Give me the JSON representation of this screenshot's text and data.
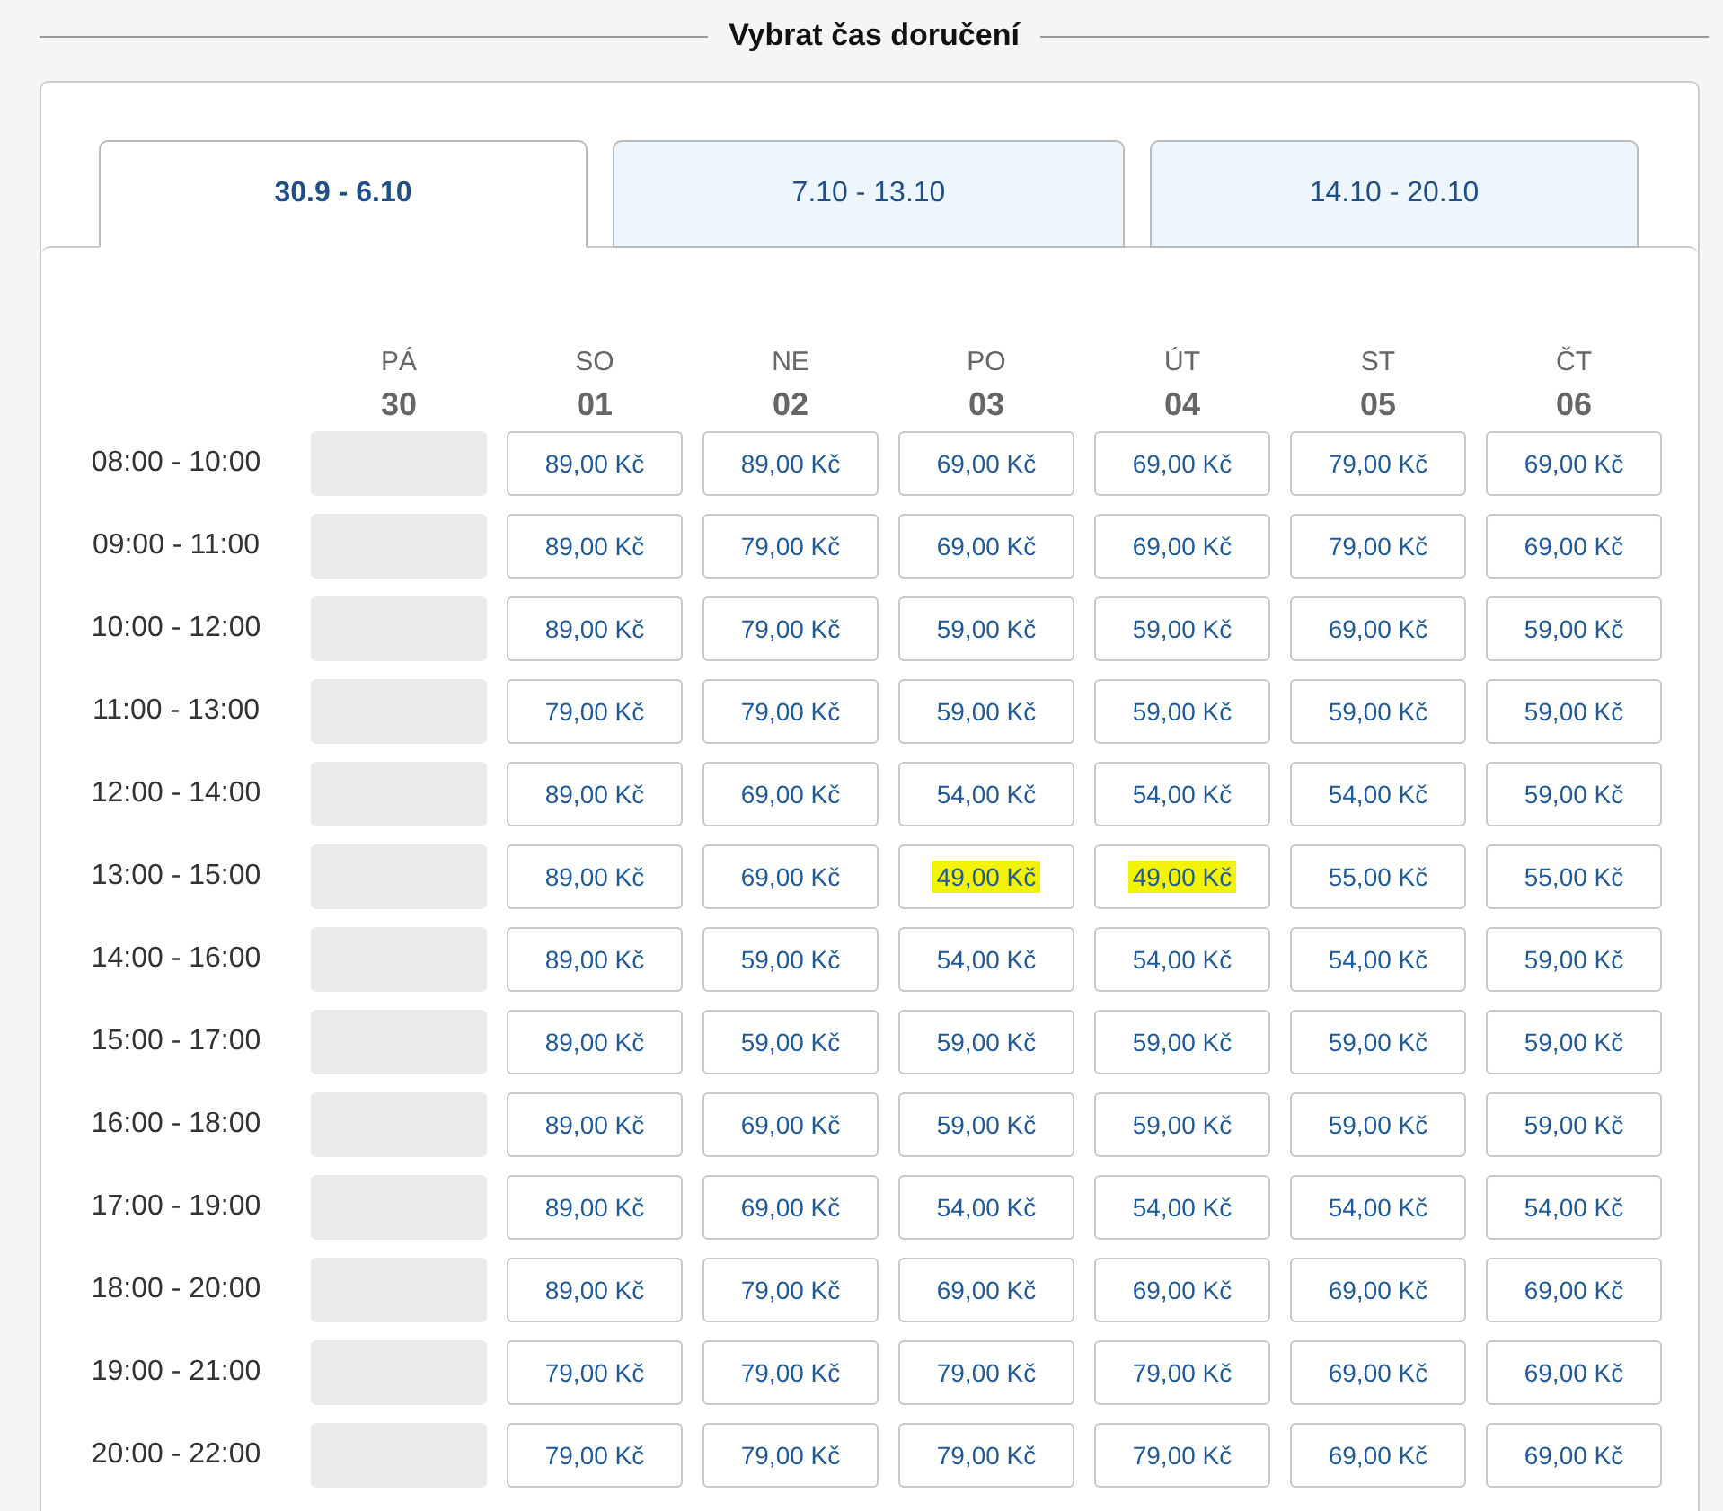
{
  "title": "Vybrat čas doručení",
  "tabs": [
    {
      "label": "30.9 - 6.10",
      "selected": true
    },
    {
      "label": "7.10 - 13.10",
      "selected": false
    },
    {
      "label": "14.10 - 20.10",
      "selected": false
    }
  ],
  "days": [
    {
      "name": "PÁ",
      "date": "30"
    },
    {
      "name": "SO",
      "date": "01"
    },
    {
      "name": "NE",
      "date": "02"
    },
    {
      "name": "PO",
      "date": "03"
    },
    {
      "name": "ÚT",
      "date": "04"
    },
    {
      "name": "ST",
      "date": "05"
    },
    {
      "name": "ČT",
      "date": "06"
    }
  ],
  "rows": [
    {
      "time": "08:00 - 10:00",
      "slots": [
        {
          "available": false
        },
        {
          "available": true,
          "price": "89,00 Kč",
          "highlighted": false
        },
        {
          "available": true,
          "price": "89,00 Kč",
          "highlighted": false
        },
        {
          "available": true,
          "price": "69,00 Kč",
          "highlighted": false
        },
        {
          "available": true,
          "price": "69,00 Kč",
          "highlighted": false
        },
        {
          "available": true,
          "price": "79,00 Kč",
          "highlighted": false
        },
        {
          "available": true,
          "price": "69,00 Kč",
          "highlighted": false
        }
      ]
    },
    {
      "time": "09:00 - 11:00",
      "slots": [
        {
          "available": false
        },
        {
          "available": true,
          "price": "89,00 Kč",
          "highlighted": false
        },
        {
          "available": true,
          "price": "79,00 Kč",
          "highlighted": false
        },
        {
          "available": true,
          "price": "69,00 Kč",
          "highlighted": false
        },
        {
          "available": true,
          "price": "69,00 Kč",
          "highlighted": false
        },
        {
          "available": true,
          "price": "79,00 Kč",
          "highlighted": false
        },
        {
          "available": true,
          "price": "69,00 Kč",
          "highlighted": false
        }
      ]
    },
    {
      "time": "10:00 - 12:00",
      "slots": [
        {
          "available": false
        },
        {
          "available": true,
          "price": "89,00 Kč",
          "highlighted": false
        },
        {
          "available": true,
          "price": "79,00 Kč",
          "highlighted": false
        },
        {
          "available": true,
          "price": "59,00 Kč",
          "highlighted": false
        },
        {
          "available": true,
          "price": "59,00 Kč",
          "highlighted": false
        },
        {
          "available": true,
          "price": "69,00 Kč",
          "highlighted": false
        },
        {
          "available": true,
          "price": "59,00 Kč",
          "highlighted": false
        }
      ]
    },
    {
      "time": "11:00 - 13:00",
      "slots": [
        {
          "available": false
        },
        {
          "available": true,
          "price": "79,00 Kč",
          "highlighted": false
        },
        {
          "available": true,
          "price": "79,00 Kč",
          "highlighted": false
        },
        {
          "available": true,
          "price": "59,00 Kč",
          "highlighted": false
        },
        {
          "available": true,
          "price": "59,00 Kč",
          "highlighted": false
        },
        {
          "available": true,
          "price": "59,00 Kč",
          "highlighted": false
        },
        {
          "available": true,
          "price": "59,00 Kč",
          "highlighted": false
        }
      ]
    },
    {
      "time": "12:00 - 14:00",
      "slots": [
        {
          "available": false
        },
        {
          "available": true,
          "price": "89,00 Kč",
          "highlighted": false
        },
        {
          "available": true,
          "price": "69,00 Kč",
          "highlighted": false
        },
        {
          "available": true,
          "price": "54,00 Kč",
          "highlighted": false
        },
        {
          "available": true,
          "price": "54,00 Kč",
          "highlighted": false
        },
        {
          "available": true,
          "price": "54,00 Kč",
          "highlighted": false
        },
        {
          "available": true,
          "price": "59,00 Kč",
          "highlighted": false
        }
      ]
    },
    {
      "time": "13:00 - 15:00",
      "slots": [
        {
          "available": false
        },
        {
          "available": true,
          "price": "89,00 Kč",
          "highlighted": false
        },
        {
          "available": true,
          "price": "69,00 Kč",
          "highlighted": false
        },
        {
          "available": true,
          "price": "49,00 Kč",
          "highlighted": true
        },
        {
          "available": true,
          "price": "49,00 Kč",
          "highlighted": true
        },
        {
          "available": true,
          "price": "55,00 Kč",
          "highlighted": false
        },
        {
          "available": true,
          "price": "55,00 Kč",
          "highlighted": false
        }
      ]
    },
    {
      "time": "14:00 - 16:00",
      "slots": [
        {
          "available": false
        },
        {
          "available": true,
          "price": "89,00 Kč",
          "highlighted": false
        },
        {
          "available": true,
          "price": "59,00 Kč",
          "highlighted": false
        },
        {
          "available": true,
          "price": "54,00 Kč",
          "highlighted": false
        },
        {
          "available": true,
          "price": "54,00 Kč",
          "highlighted": false
        },
        {
          "available": true,
          "price": "54,00 Kč",
          "highlighted": false
        },
        {
          "available": true,
          "price": "59,00 Kč",
          "highlighted": false
        }
      ]
    },
    {
      "time": "15:00 - 17:00",
      "slots": [
        {
          "available": false
        },
        {
          "available": true,
          "price": "89,00 Kč",
          "highlighted": false
        },
        {
          "available": true,
          "price": "59,00 Kč",
          "highlighted": false
        },
        {
          "available": true,
          "price": "59,00 Kč",
          "highlighted": false
        },
        {
          "available": true,
          "price": "59,00 Kč",
          "highlighted": false
        },
        {
          "available": true,
          "price": "59,00 Kč",
          "highlighted": false
        },
        {
          "available": true,
          "price": "59,00 Kč",
          "highlighted": false
        }
      ]
    },
    {
      "time": "16:00 - 18:00",
      "slots": [
        {
          "available": false
        },
        {
          "available": true,
          "price": "89,00 Kč",
          "highlighted": false
        },
        {
          "available": true,
          "price": "69,00 Kč",
          "highlighted": false
        },
        {
          "available": true,
          "price": "59,00 Kč",
          "highlighted": false
        },
        {
          "available": true,
          "price": "59,00 Kč",
          "highlighted": false
        },
        {
          "available": true,
          "price": "59,00 Kč",
          "highlighted": false
        },
        {
          "available": true,
          "price": "59,00 Kč",
          "highlighted": false
        }
      ]
    },
    {
      "time": "17:00 - 19:00",
      "slots": [
        {
          "available": false
        },
        {
          "available": true,
          "price": "89,00 Kč",
          "highlighted": false
        },
        {
          "available": true,
          "price": "69,00 Kč",
          "highlighted": false
        },
        {
          "available": true,
          "price": "54,00 Kč",
          "highlighted": false
        },
        {
          "available": true,
          "price": "54,00 Kč",
          "highlighted": false
        },
        {
          "available": true,
          "price": "54,00 Kč",
          "highlighted": false
        },
        {
          "available": true,
          "price": "54,00 Kč",
          "highlighted": false
        }
      ]
    },
    {
      "time": "18:00 - 20:00",
      "slots": [
        {
          "available": false
        },
        {
          "available": true,
          "price": "89,00 Kč",
          "highlighted": false
        },
        {
          "available": true,
          "price": "79,00 Kč",
          "highlighted": false
        },
        {
          "available": true,
          "price": "69,00 Kč",
          "highlighted": false
        },
        {
          "available": true,
          "price": "69,00 Kč",
          "highlighted": false
        },
        {
          "available": true,
          "price": "69,00 Kč",
          "highlighted": false
        },
        {
          "available": true,
          "price": "69,00 Kč",
          "highlighted": false
        }
      ]
    },
    {
      "time": "19:00 - 21:00",
      "slots": [
        {
          "available": false
        },
        {
          "available": true,
          "price": "79,00 Kč",
          "highlighted": false
        },
        {
          "available": true,
          "price": "79,00 Kč",
          "highlighted": false
        },
        {
          "available": true,
          "price": "79,00 Kč",
          "highlighted": false
        },
        {
          "available": true,
          "price": "79,00 Kč",
          "highlighted": false
        },
        {
          "available": true,
          "price": "69,00 Kč",
          "highlighted": false
        },
        {
          "available": true,
          "price": "69,00 Kč",
          "highlighted": false
        }
      ]
    },
    {
      "time": "20:00 - 22:00",
      "slots": [
        {
          "available": false
        },
        {
          "available": true,
          "price": "79,00 Kč",
          "highlighted": false
        },
        {
          "available": true,
          "price": "79,00 Kč",
          "highlighted": false
        },
        {
          "available": true,
          "price": "79,00 Kč",
          "highlighted": false
        },
        {
          "available": true,
          "price": "79,00 Kč",
          "highlighted": false
        },
        {
          "available": true,
          "price": "69,00 Kč",
          "highlighted": false
        },
        {
          "available": true,
          "price": "69,00 Kč",
          "highlighted": false
        }
      ]
    }
  ]
}
